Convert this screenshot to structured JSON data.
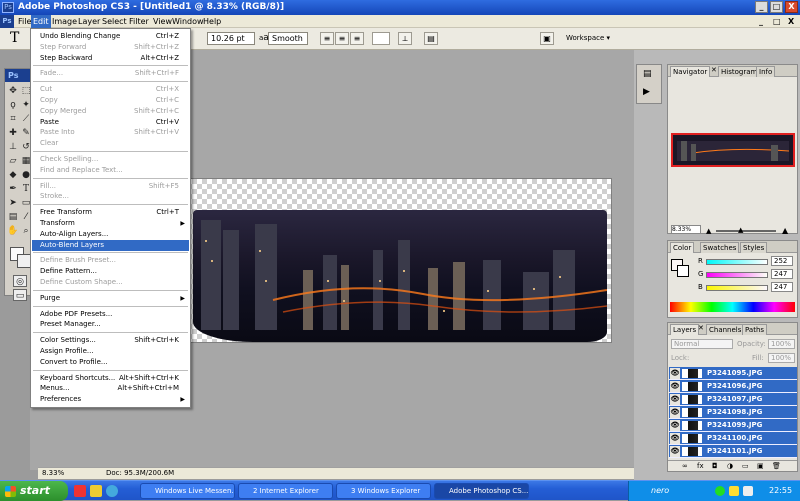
{
  "window": {
    "title": "Adobe Photoshop CS3 - [Untitled1 @ 8.33% (RGB/8)]",
    "app_icon": "Ps",
    "controls": [
      "_",
      "□",
      "X"
    ]
  },
  "menubar": {
    "items": [
      "File",
      "Edit",
      "Image",
      "Layer",
      "Select",
      "Filter",
      "View",
      "Window",
      "Help"
    ],
    "doc_controls": [
      "_",
      "□",
      "X"
    ]
  },
  "options": {
    "tool_glyph": "T",
    "font_size": "10.26 pt",
    "aa_label": "a",
    "aa_value": "Smooth",
    "workspace": "Workspace ▾"
  },
  "edit_menu": [
    {
      "label": "Undo Blending Change",
      "shortcut": "Ctrl+Z",
      "disabled": false
    },
    {
      "label": "Step Forward",
      "shortcut": "Shift+Ctrl+Z",
      "disabled": true
    },
    {
      "label": "Step Backward",
      "shortcut": "Alt+Ctrl+Z",
      "disabled": false
    },
    {
      "sep": true
    },
    {
      "label": "Fade...",
      "shortcut": "Shift+Ctrl+F",
      "disabled": true
    },
    {
      "sep": true
    },
    {
      "label": "Cut",
      "shortcut": "Ctrl+X",
      "disabled": true
    },
    {
      "label": "Copy",
      "shortcut": "Ctrl+C",
      "disabled": true
    },
    {
      "label": "Copy Merged",
      "shortcut": "Shift+Ctrl+C",
      "disabled": true
    },
    {
      "label": "Paste",
      "shortcut": "Ctrl+V",
      "disabled": false
    },
    {
      "label": "Paste Into",
      "shortcut": "Shift+Ctrl+V",
      "disabled": true
    },
    {
      "label": "Clear",
      "shortcut": "",
      "disabled": true
    },
    {
      "sep": true
    },
    {
      "label": "Check Spelling...",
      "shortcut": "",
      "disabled": true
    },
    {
      "label": "Find and Replace Text...",
      "shortcut": "",
      "disabled": true
    },
    {
      "sep": true
    },
    {
      "label": "Fill...",
      "shortcut": "Shift+F5",
      "disabled": true
    },
    {
      "label": "Stroke...",
      "shortcut": "",
      "disabled": true
    },
    {
      "sep": true
    },
    {
      "label": "Free Transform",
      "shortcut": "Ctrl+T",
      "disabled": false
    },
    {
      "label": "Transform",
      "shortcut": "",
      "disabled": false,
      "submenu": true
    },
    {
      "label": "Auto-Align Layers...",
      "shortcut": "",
      "disabled": false
    },
    {
      "label": "Auto-Blend Layers",
      "shortcut": "",
      "disabled": false,
      "highlight": true
    },
    {
      "sep": true
    },
    {
      "label": "Define Brush Preset...",
      "shortcut": "",
      "disabled": true
    },
    {
      "label": "Define Pattern...",
      "shortcut": "",
      "disabled": false
    },
    {
      "label": "Define Custom Shape...",
      "shortcut": "",
      "disabled": true
    },
    {
      "sep": true
    },
    {
      "label": "Purge",
      "shortcut": "",
      "disabled": false,
      "submenu": true
    },
    {
      "sep": true
    },
    {
      "label": "Adobe PDF Presets...",
      "shortcut": "",
      "disabled": false
    },
    {
      "label": "Preset Manager...",
      "shortcut": "",
      "disabled": false
    },
    {
      "sep": true
    },
    {
      "label": "Color Settings...",
      "shortcut": "Shift+Ctrl+K",
      "disabled": false
    },
    {
      "label": "Assign Profile...",
      "shortcut": "",
      "disabled": false
    },
    {
      "label": "Convert to Profile...",
      "shortcut": "",
      "disabled": false
    },
    {
      "sep": true
    },
    {
      "label": "Keyboard Shortcuts...",
      "shortcut": "Alt+Shift+Ctrl+K",
      "disabled": false
    },
    {
      "label": "Menus...",
      "shortcut": "Alt+Shift+Ctrl+M",
      "disabled": false
    },
    {
      "label": "Preferences",
      "shortcut": "",
      "disabled": false,
      "submenu": true
    }
  ],
  "toolbox": {
    "header": "Ps"
  },
  "status": {
    "zoom": "8.33%",
    "doc": "Doc: 95.3M/200.6M"
  },
  "navigator": {
    "tabs": [
      "Navigator",
      "Histogram",
      "Info"
    ],
    "zoom": "8.33%"
  },
  "color_panel": {
    "tabs": [
      "Color",
      "Swatches",
      "Styles"
    ],
    "channels": [
      {
        "label": "R",
        "value": "252"
      },
      {
        "label": "G",
        "value": "247"
      },
      {
        "label": "B",
        "value": "247"
      }
    ]
  },
  "layers_panel": {
    "tabs": [
      "Layers",
      "Channels",
      "Paths"
    ],
    "blend_mode": "Normal",
    "opacity_label": "Opacity:",
    "opacity": "100%",
    "lock_label": "Lock:",
    "fill_label": "Fill:",
    "fill": "100%",
    "layers": [
      "P3241095.JPG",
      "P3241096.JPG",
      "P3241097.JPG",
      "P3241098.JPG",
      "P3241099.JPG",
      "P3241100.JPG",
      "P3241101.JPG"
    ],
    "footer_icons": [
      "link-icon",
      "fx-icon",
      "mask-icon",
      "adjustment-icon",
      "group-icon",
      "new-layer-icon",
      "trash-icon"
    ]
  },
  "taskbar": {
    "start": "start",
    "tasks": [
      "Windows Live Messen...",
      "2 Internet Explorer",
      "3 Windows Explorer",
      "Adobe Photoshop CS..."
    ],
    "tray_app": "nero",
    "time": "22:55"
  }
}
